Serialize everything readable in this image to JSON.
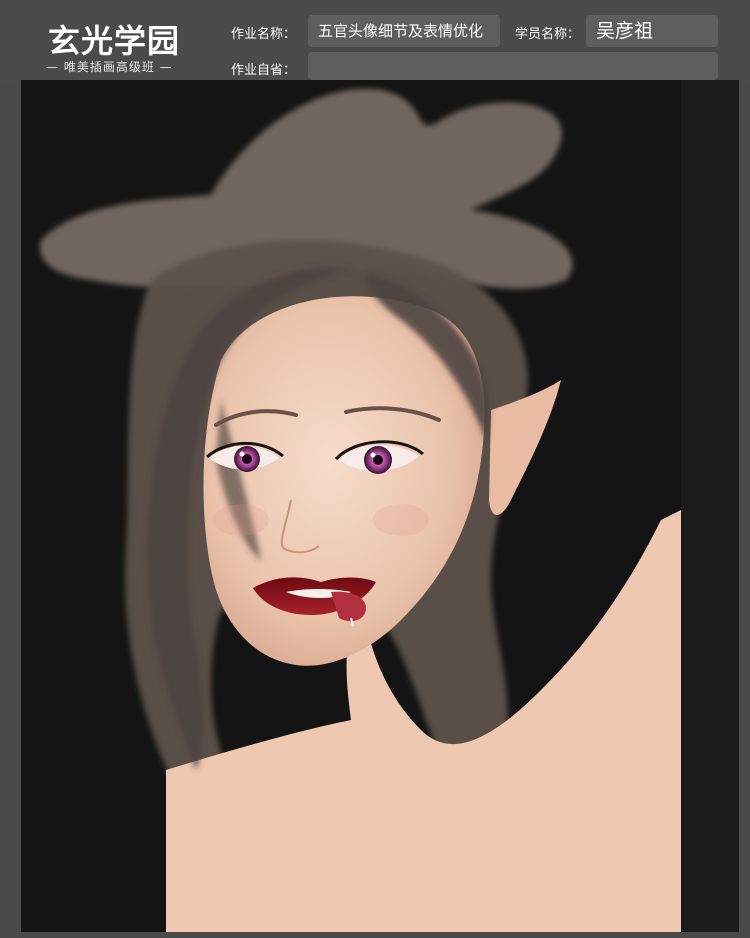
{
  "header": {
    "logo_main": "玄光学园",
    "logo_sub": "— 唯美插画高级班 —",
    "assignment_name_label": "作业名称：",
    "assignment_name_value": "五官头像细节及表情优化",
    "student_name_label": "学员名称：",
    "student_name_value": "吴彦祖",
    "self_review_label": "作业自省：",
    "self_review_value": ""
  },
  "colors": {
    "header_bg": "#4b4b4b",
    "field_bg": "#5e5e5e",
    "canvas_bg": "#161616",
    "skin": "#efc8b2",
    "hair": "#6a5c55",
    "lips": "#8a1018",
    "iris": "#b24fa0"
  },
  "artwork": {
    "icon": "portrait-illustration-icon"
  }
}
